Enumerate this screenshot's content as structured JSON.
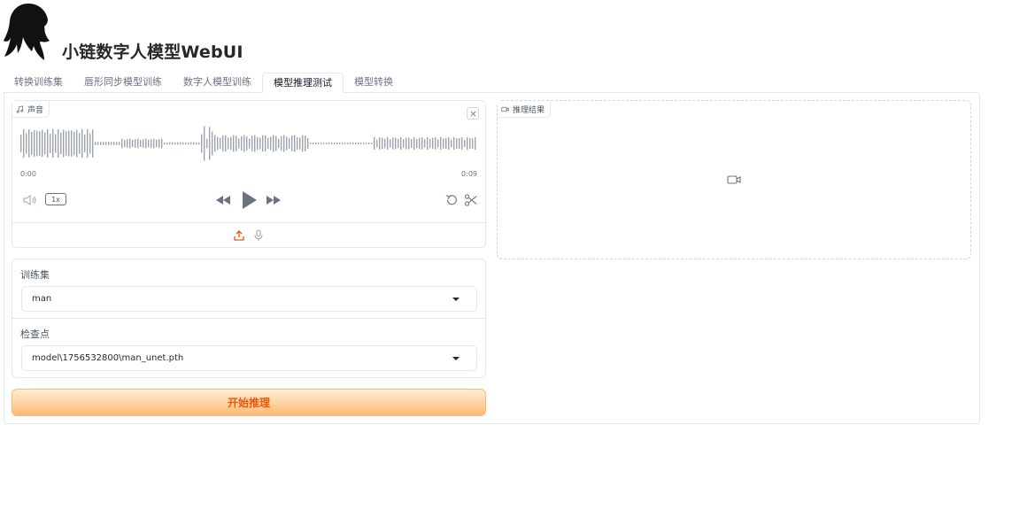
{
  "header": {
    "title": "小链数字人模型WebUI"
  },
  "tabs": [
    {
      "label": "转换训练集"
    },
    {
      "label": "唇形同步模型训练"
    },
    {
      "label": "数字人模型训练"
    },
    {
      "label": "模型推理测试",
      "active": true
    },
    {
      "label": "模型转换"
    }
  ],
  "audio": {
    "label": "声音",
    "time_start": "0:00",
    "time_end": "0:09",
    "playback_rate": "1x"
  },
  "result": {
    "label": "推理结果"
  },
  "form": {
    "dataset_label": "训练集",
    "dataset_value": "man",
    "checkpoint_label": "检查点",
    "checkpoint_value": "model\\1756532800\\man_unet.pth"
  },
  "actions": {
    "start_label": "开始推理"
  },
  "colors": {
    "accent": "#ea580c",
    "accent_light": "#fdba74",
    "border": "#e5e7eb",
    "text_muted": "#6b7280"
  }
}
